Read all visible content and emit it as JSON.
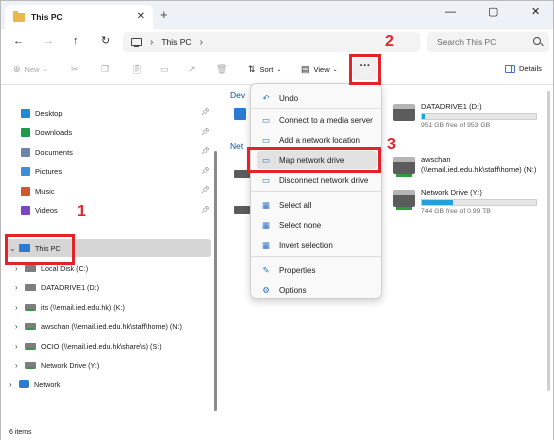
{
  "tab": {
    "title": "This PC",
    "close": "✕",
    "new": "+"
  },
  "window_controls": {
    "minimize": "—",
    "maximize": "▢",
    "close": "✕"
  },
  "nav": {
    "back": "←",
    "forward": "→",
    "up": "↑",
    "refresh": "↻"
  },
  "address": {
    "separator": "›",
    "crumb": "This PC",
    "trailing": "›"
  },
  "search": {
    "placeholder": "Search This PC"
  },
  "toolbar": {
    "new_label": "New",
    "sort_label": "Sort",
    "view_label": "View",
    "more_label": "···",
    "details_label": "Details"
  },
  "quick_access": [
    {
      "label": "Desktop",
      "color": "#1f8ad8"
    },
    {
      "label": "Downloads",
      "color": "#1f9a4a"
    },
    {
      "label": "Documents",
      "color": "#6b86a8"
    },
    {
      "label": "Pictures",
      "color": "#3a8fd6"
    },
    {
      "label": "Music",
      "color": "#d4572a"
    },
    {
      "label": "Videos",
      "color": "#7a44c2"
    }
  ],
  "tree": {
    "this_pc": "This PC",
    "items": [
      "Local Disk (C:)",
      "DATADRIVE1 (D:)",
      "its (\\\\email.ied.edu.hk) (K:)",
      "awschan (\\\\email.ied.edu.hk\\staff\\home) (N:)",
      "OCIO (\\\\email.ied.edu.hk\\share\\s) (S:)",
      "Network Drive (Y:)"
    ],
    "network": "Network"
  },
  "content": {
    "group_devices": "Dev",
    "group_network": "Net",
    "drives": [
      {
        "name": "DATADRIVE1 (D:)",
        "free": "951 GB free of 953 GB",
        "used_fraction": 0.002
      },
      {
        "name": "awschan (\\\\email.ied.edu.hk\\staff\\home) (N:)",
        "free": "",
        "used_fraction": null
      },
      {
        "name": "Network Drive (Y:)",
        "free": "744 GB free of 0.99 TB",
        "used_fraction": 0.27
      }
    ]
  },
  "menu": {
    "items": [
      {
        "label": "Undo",
        "icon": "undo-icon",
        "glyph": "↶"
      },
      {
        "label": "Connect to a media server",
        "icon": "media-server-icon",
        "glyph": "▭"
      },
      {
        "label": "Add a network location",
        "icon": "network-location-icon",
        "glyph": "▭"
      },
      {
        "label": "Map network drive",
        "icon": "map-drive-icon",
        "glyph": "▭"
      },
      {
        "label": "Disconnect network drive",
        "icon": "disconnect-drive-icon",
        "glyph": "▭"
      },
      {
        "label": "Select all",
        "icon": "select-all-icon",
        "glyph": "▦"
      },
      {
        "label": "Select none",
        "icon": "select-none-icon",
        "glyph": "▦"
      },
      {
        "label": "Invert selection",
        "icon": "invert-selection-icon",
        "glyph": "▦"
      },
      {
        "label": "Properties",
        "icon": "properties-icon",
        "glyph": "✎"
      },
      {
        "label": "Options",
        "icon": "options-icon",
        "glyph": "⚙"
      }
    ]
  },
  "annotations": {
    "one": "1",
    "two": "2",
    "three": "3"
  },
  "status": {
    "count": "6 items"
  },
  "colors": {
    "accent": "#26a0da",
    "annotation": "#e2232a",
    "folder": "#e8b94a"
  }
}
